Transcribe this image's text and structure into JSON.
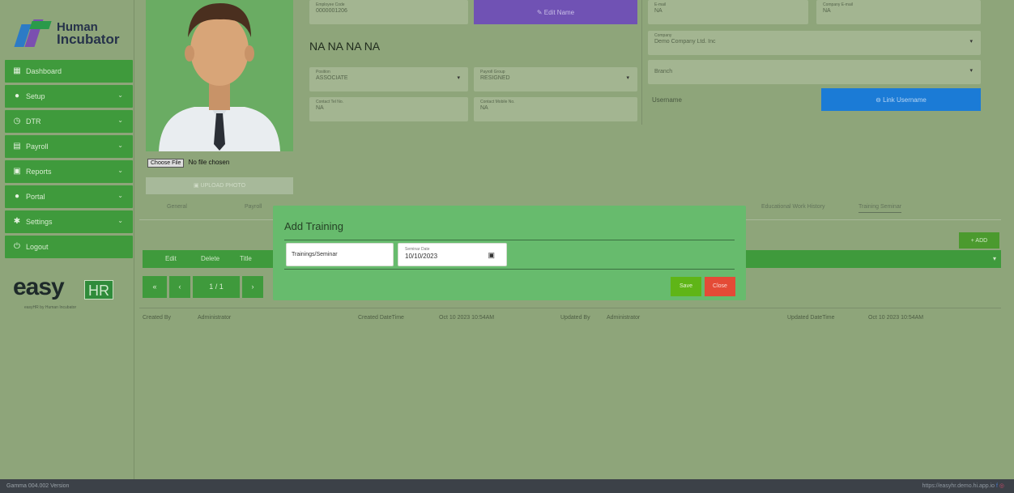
{
  "brand": {
    "line1": "Human",
    "line2": "Incubator",
    "easy": "easy",
    "hr": "HR",
    "byline": "easyHR by Human Incubator"
  },
  "sidebar": {
    "items": [
      {
        "label": "Dashboard",
        "icon": "dashboard-icon",
        "chev": ""
      },
      {
        "label": "Setup",
        "icon": "gear-icon",
        "chev": "⌄"
      },
      {
        "label": "DTR",
        "icon": "clock-icon",
        "chev": "⌄"
      },
      {
        "label": "Payroll",
        "icon": "payroll-icon",
        "chev": "⌄"
      },
      {
        "label": "Reports",
        "icon": "print-icon",
        "chev": "⌄"
      },
      {
        "label": "Portal",
        "icon": "portal-icon",
        "chev": "⌄"
      },
      {
        "label": "Settings",
        "icon": "settings-icon",
        "chev": "⌄"
      },
      {
        "label": "Logout",
        "icon": "power-icon",
        "chev": ""
      }
    ]
  },
  "profile": {
    "choose_file": "Choose File",
    "no_file": "No file chosen",
    "upload": "UPLOAD PHOTO",
    "employee_no_label": "Employee Code",
    "employee_no": "0000001206",
    "edit_name": "Edit Name",
    "full_name": "NA NA  NA NA",
    "position_label": "Position",
    "position": "ASSOCIATE",
    "payroll_group_label": "Payroll Group",
    "payroll_group": "RESIGNED",
    "contact_tel_label": "Contact Tel No.",
    "contact_tel": "NA",
    "contact_mobile_label": "Contact Mobile No.",
    "contact_mobile": "NA",
    "email_label": "E-mail",
    "email": "NA",
    "company_label": "Company",
    "company": "Demo Company Ltd. Inc",
    "branch": "Branch",
    "username": "Username",
    "link_username": "Link Username",
    "tin_label": "Company E-mail",
    "tin": "NA"
  },
  "tabs": [
    "General",
    "Payroll",
    "Educational Work History",
    "Training Seminar"
  ],
  "toolbar": {
    "add": "+ ADD"
  },
  "table": {
    "headers": [
      "Edit",
      "Delete",
      "Title"
    ]
  },
  "pager": {
    "first": "«",
    "prev": "‹",
    "page": "1 / 1",
    "next": "›"
  },
  "meta": {
    "created_by_label": "Created By",
    "created_by": "Administrator",
    "created_dt_label": "Created DateTime",
    "created_dt": "Oct 10 2023 10:54AM",
    "updated_by_label": "Updated By",
    "updated_by": "Administrator",
    "updated_dt_label": "Updated DateTime",
    "updated_dt": "Oct 10 2023 10:54AM"
  },
  "modal": {
    "title": "Add Training",
    "training_placeholder": "Trainings/Seminar",
    "date_label": "Seminar Date",
    "date_value": "10/10/2023",
    "save": "Save",
    "close": "Close"
  },
  "footer": {
    "version": "Gamma 004.002 Version",
    "url": "https://easyhr.demo.hi.app.io"
  },
  "colors": {
    "nav_green": "#3f9a3c",
    "modal_green": "#67bb6d",
    "save": "#5fb517",
    "close": "#e44b36",
    "link_blue": "#1b7bd6",
    "edit_purple": "#7052b4"
  }
}
